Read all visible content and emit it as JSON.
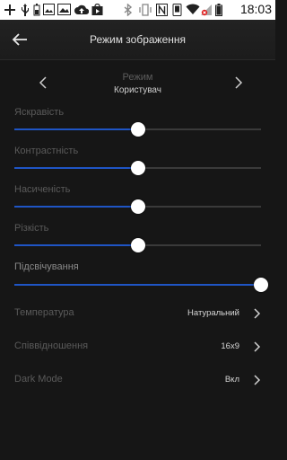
{
  "status_bar": {
    "time": "18:03",
    "icons": [
      "add-icon",
      "usb-icon",
      "battery-small-icon",
      "image-icon",
      "cloud-upload-icon",
      "play-store-icon",
      "bluetooth-icon",
      "vibrate-icon",
      "nfc-icon",
      "phone-icon",
      "wifi-icon",
      "signal-no-sim-icon",
      "battery-icon"
    ]
  },
  "header": {
    "title": "Режим зображення"
  },
  "mode": {
    "label": "Режим",
    "value": "Користувач"
  },
  "sliders": [
    {
      "label": "Яскравість",
      "value": 0.5
    },
    {
      "label": "Контрастність",
      "value": 0.5
    },
    {
      "label": "Насиченість",
      "value": 0.5
    },
    {
      "label": "Різкість",
      "value": 0.5
    },
    {
      "label": "Підсвічування",
      "value": 1.0
    }
  ],
  "options": [
    {
      "label": "Температура",
      "value": "Натуральний"
    },
    {
      "label": "Співвідношення",
      "value": "16x9"
    },
    {
      "label": "Dark Mode",
      "value": "Вкл"
    }
  ],
  "colors": {
    "accent": "#1f55c5",
    "background": "#161616",
    "thumb": "#ffffff"
  }
}
